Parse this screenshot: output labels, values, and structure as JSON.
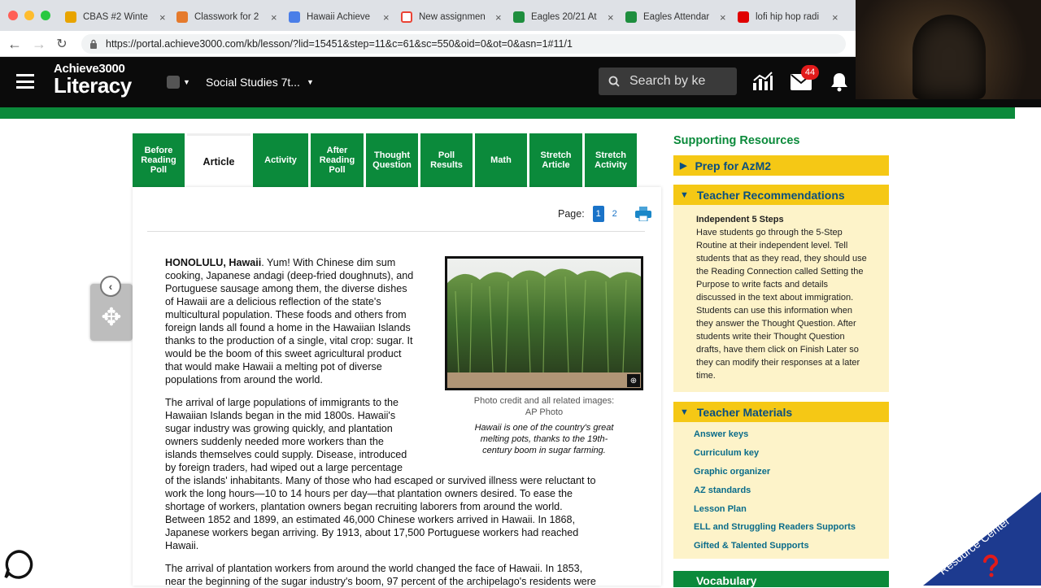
{
  "browser": {
    "tabs": [
      {
        "title": "CBAS #2 Winte",
        "color": "#e8a400"
      },
      {
        "title": "Classwork for 2",
        "color": "#e57a2c"
      },
      {
        "title": "Hawaii Achieve",
        "color": "#4a7ee8"
      },
      {
        "title": "New assignmen",
        "color": "#ea4335"
      },
      {
        "title": "Eagles 20/21 At",
        "color": "#1e8e3e"
      },
      {
        "title": "Eagles Attendar",
        "color": "#1e8e3e"
      },
      {
        "title": "lofi hip hop radi",
        "color": "#e00000"
      }
    ],
    "tab_close": "×",
    "url": "https://portal.achieve3000.com/kb/lesson/?lid=15451&step=11&c=61&sc=550&oid=0&ot=0&asn=1#11/1"
  },
  "header": {
    "logo_top": "Achieve3000",
    "logo_bottom": "Literacy",
    "class_select": "Social Studies 7t...",
    "search_placeholder": "Search by ke",
    "mail_badge": "44"
  },
  "nav_tabs": [
    {
      "label": "Before Reading Poll",
      "active": false
    },
    {
      "label": "Article",
      "active": true
    },
    {
      "label": "Activity",
      "active": false
    },
    {
      "label": "After Reading Poll",
      "active": false
    },
    {
      "label": "Thought Question",
      "active": false
    },
    {
      "label": "Poll Results",
      "active": false
    },
    {
      "label": "Math",
      "active": false
    },
    {
      "label": "Stretch Article",
      "active": false
    },
    {
      "label": "Stretch Activity",
      "active": false
    }
  ],
  "article": {
    "page_label": "Page:",
    "pages": [
      "1",
      "2"
    ],
    "p1_lines": [
      {
        "pre": "HONOLULU, Hawaii",
        "rest": ". Yum! With Chinese dim sum"
      },
      {
        "pre": "",
        "rest": "cooking, Japanese andagi (deep-fried doughnuts), and"
      },
      {
        "pre": "",
        "rest": "Portuguese sausage among them, the diverse dishes"
      },
      {
        "pre": "",
        "rest": "of Hawaii are a delicious reflection of the state's"
      },
      {
        "pre": "",
        "rest": "multicultural population. These foods and others from"
      },
      {
        "pre": "",
        "rest": "foreign lands all found a home in the Hawaiian Islands"
      },
      {
        "pre": "",
        "rest": "thanks to the production of a single, vital crop: sugar. It"
      },
      {
        "pre": "",
        "rest": "would be the boom of this sweet agricultural product"
      },
      {
        "pre": "",
        "rest": "that would make Hawaii a melting pot of diverse"
      },
      {
        "pre": "",
        "rest": "populations from around the world."
      }
    ],
    "p2_lines": [
      "The arrival of large populations of immigrants to the",
      "Hawaiian Islands began in the mid 1800s. Hawaii's",
      "sugar industry was growing quickly, and plantation",
      "owners suddenly needed more workers than the",
      "islands themselves could supply. Disease, introduced",
      "by foreign traders, had wiped out a large percentage",
      "of the islands' inhabitants. Many of those who had escaped or survived illness were reluctant to",
      "work the long hours—10 to 14 hours per day—that plantation owners desired. To ease the",
      "shortage of workers, plantation owners began recruiting laborers from around the world.",
      "Between 1852 and 1899, an estimated 46,000 Chinese workers arrived in Hawaii. In 1868,",
      "Japanese workers began arriving. By 1913, about 17,500 Portuguese workers had reached",
      "Hawaii."
    ],
    "p3_lines": [
      "The arrival of plantation workers from around the world changed the face of Hawaii. In 1853,",
      "near the beginning of the sugar industry's boom, 97 percent of the archipelago's residents were"
    ],
    "photo_credit_1": "Photo credit and all related images:",
    "photo_credit_2": "AP Photo",
    "caption_lines": [
      "Hawaii is one of the country's great",
      "melting pots, thanks to the 19th-",
      "century boom in sugar farming."
    ]
  },
  "sidebar": {
    "title": "Supporting Resources",
    "prep": "Prep for AzM2",
    "teacher_rec": "Teacher Recommendations",
    "rec_title": "Independent 5 Steps",
    "rec_lines": [
      "Have students go through the 5-Step",
      "Routine at their independent level. Tell",
      "students that as they read, they should use",
      "the Reading Connection called Setting the",
      "Purpose to write facts and details",
      "discussed in the text about immigration.",
      "Students can use this information when",
      "they answer the Thought Question. After",
      "students write their Thought Question",
      "drafts, have them click on Finish Later so",
      "they can modify their responses at a later",
      "time."
    ],
    "teacher_mat": "Teacher Materials",
    "materials": [
      "Answer keys",
      "Curriculum key",
      "Graphic organizer",
      "AZ standards",
      "Lesson Plan",
      "ELL and Struggling Readers Supports",
      "Gifted & Talented Supports"
    ],
    "vocab": "Vocabulary"
  },
  "resource_center": "Resource Center"
}
